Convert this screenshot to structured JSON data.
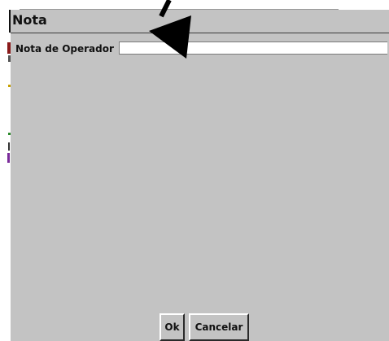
{
  "dialog": {
    "title": "Nota",
    "field_label": "Nota de Operador",
    "field_value": "",
    "field_placeholder": ""
  },
  "buttons": {
    "ok_label": "Ok",
    "cancel_label": "Cancelar"
  },
  "annotation": {
    "icon": "arrow-pointer-icon",
    "color": "#000000"
  },
  "colors": {
    "dialog_background": "#c3c3c3",
    "input_background": "#ffffff"
  }
}
